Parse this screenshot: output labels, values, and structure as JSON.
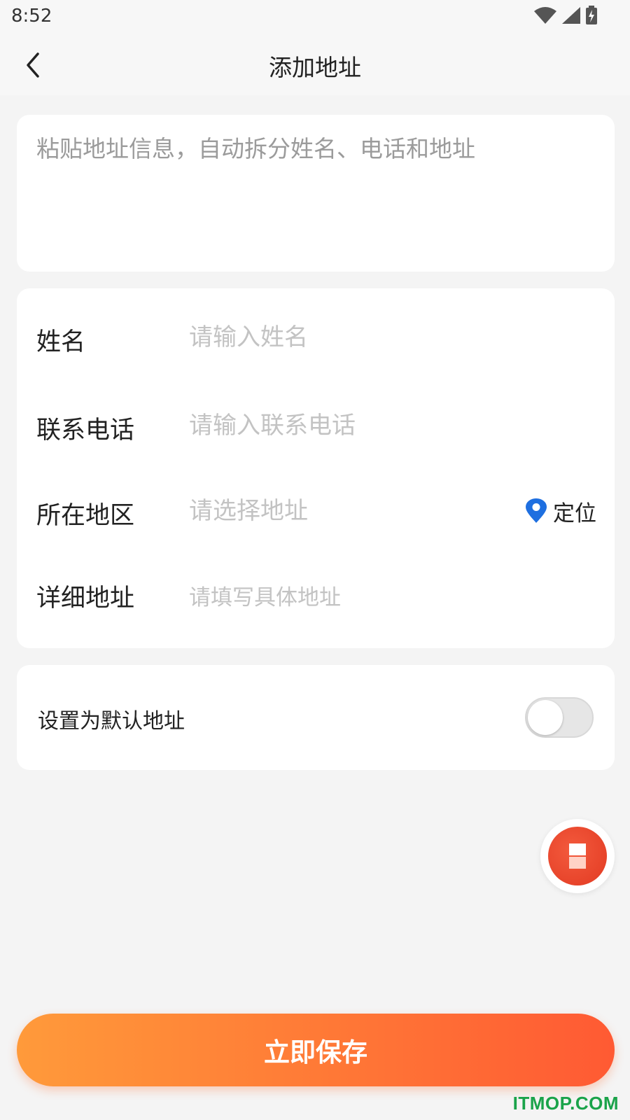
{
  "status_bar": {
    "time": "8:52",
    "icons": [
      "wifi-icon",
      "cell-signal-icon",
      "battery-charging-icon"
    ]
  },
  "header": {
    "title": "添加地址",
    "back_icon": "chevron-left-icon"
  },
  "paste": {
    "placeholder": "粘贴地址信息，自动拆分姓名、电话和地址"
  },
  "form": {
    "name": {
      "label": "姓名",
      "placeholder": "请输入姓名"
    },
    "phone": {
      "label": "联系电话",
      "placeholder": "请输入联系电话"
    },
    "region": {
      "label": "所在地区",
      "placeholder": "请选择地址",
      "locate_label": "定位"
    },
    "detail": {
      "label": "详细地址",
      "placeholder": "请填写具体地址"
    }
  },
  "default_address": {
    "label": "设置为默认地址",
    "enabled": false
  },
  "save_button": {
    "label": "立即保存"
  },
  "watermark": "ITMOP.COM",
  "colors": {
    "accent_start": "#ff9a3a",
    "accent_end": "#ff5a33",
    "locate_pin": "#1e6fe0",
    "float_button": "#e8412a"
  }
}
